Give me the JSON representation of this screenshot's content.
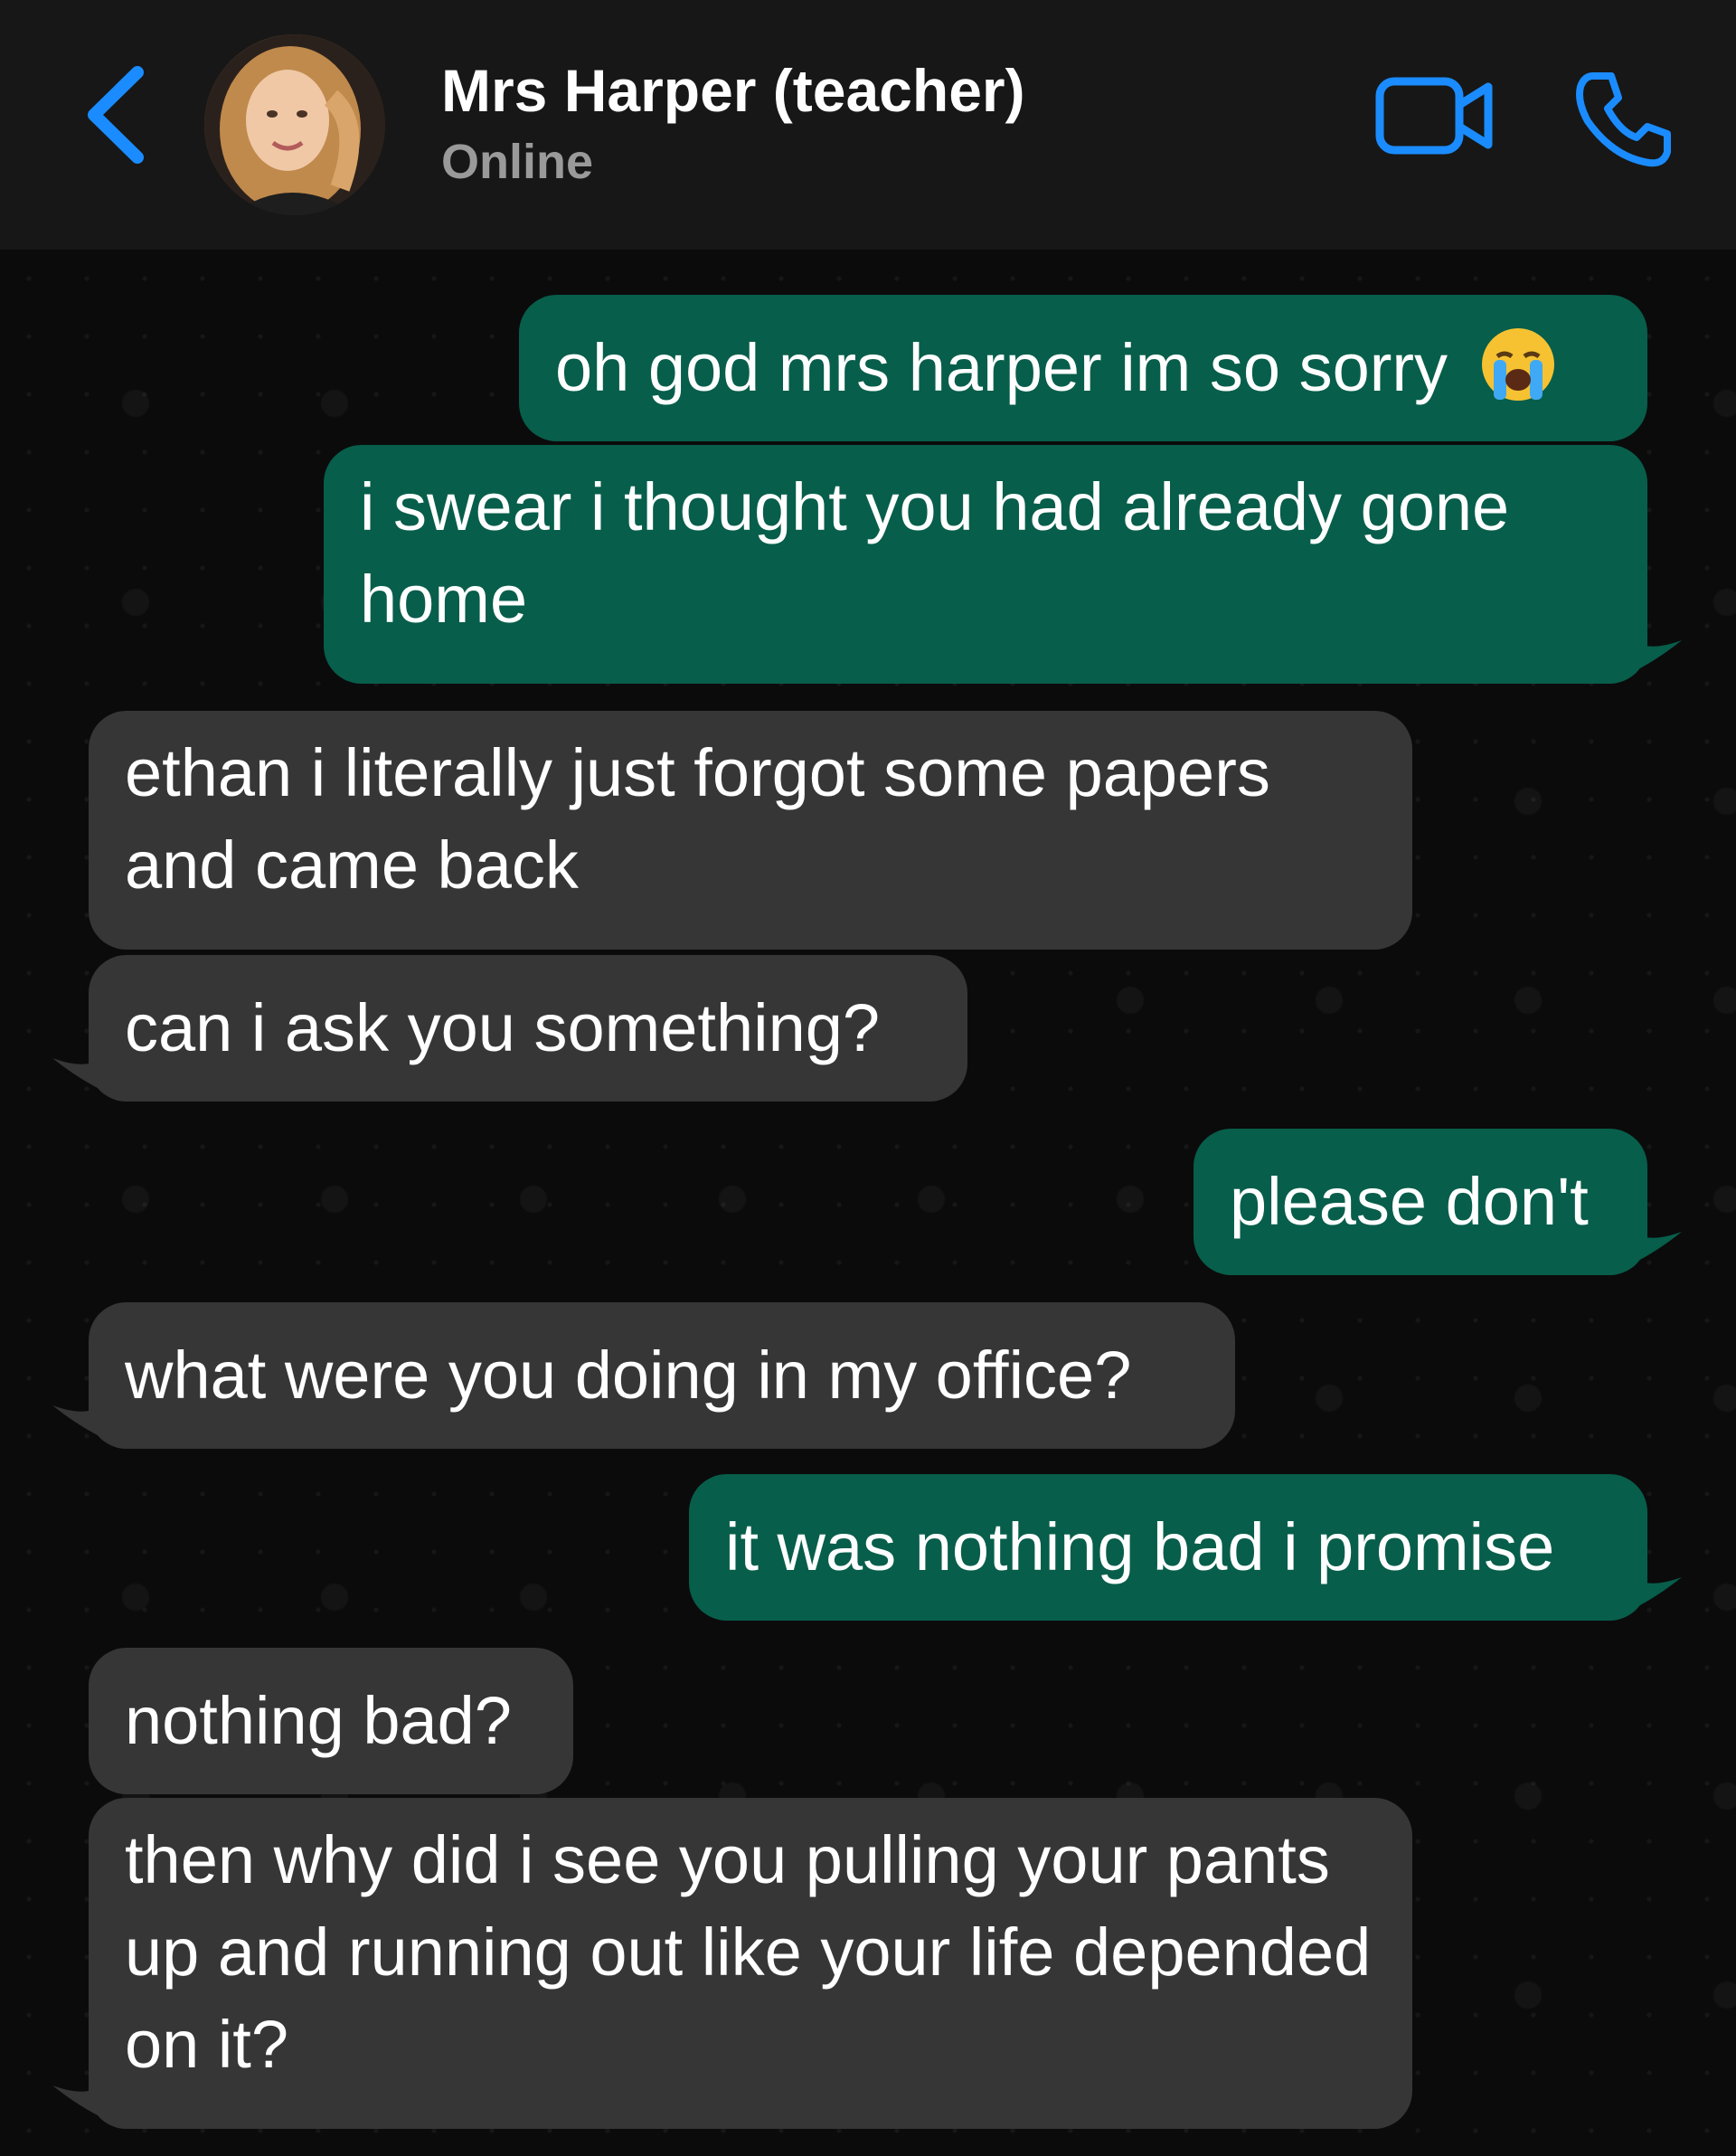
{
  "header": {
    "contact_name": "Mrs Harper (teacher)",
    "status": "Online",
    "icons": [
      "chevron-left-icon",
      "video-camera-icon",
      "phone-icon"
    ]
  },
  "colors": {
    "accent": "#1a8cff",
    "outgoing_bubble": "#075e4b",
    "incoming_bubble": "#363636",
    "header_bg": "#171717",
    "chat_bg": "#0b0b0b"
  },
  "messages": [
    {
      "direction": "outgoing",
      "text": "oh god mrs harper im so sorry",
      "emoji": "loudly-crying-face"
    },
    {
      "direction": "outgoing",
      "text": "i swear i thought you had already gone home"
    },
    {
      "direction": "incoming",
      "text": "ethan i literally just forgot some papers and came back"
    },
    {
      "direction": "incoming",
      "text": "can i ask you something?"
    },
    {
      "direction": "outgoing",
      "text": "please don't"
    },
    {
      "direction": "incoming",
      "text": "what were you doing in my office?"
    },
    {
      "direction": "outgoing",
      "text": "it was nothing bad i promise"
    },
    {
      "direction": "incoming",
      "text": "nothing bad?"
    },
    {
      "direction": "incoming",
      "text": "then why did i see you pulling your pants up and running out like your life depended on it?"
    }
  ]
}
